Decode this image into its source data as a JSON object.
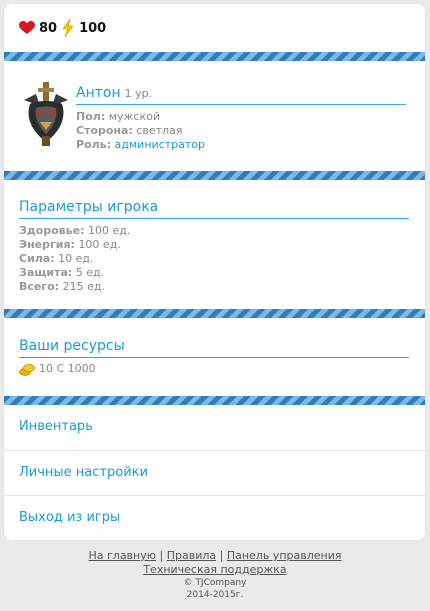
{
  "header": {
    "health_value": "80",
    "energy_value": "100"
  },
  "profile": {
    "name": "Антон",
    "level": "1 ур.",
    "fields": [
      {
        "label": "Пол:",
        "value": "мужской"
      },
      {
        "label": "Сторона:",
        "value": "светлая"
      },
      {
        "label": "Роль:",
        "value": "администратор"
      }
    ]
  },
  "stats": {
    "title": "Параметры игрока",
    "rows": [
      {
        "label": "Здоровье:",
        "value": "100 ед."
      },
      {
        "label": "Энергия:",
        "value": "100 ед."
      },
      {
        "label": "Сила:",
        "value": "10 ед."
      },
      {
        "label": "Защита:",
        "value": "5 ед."
      },
      {
        "label": "Всего:",
        "value": "215 ед."
      }
    ]
  },
  "resources": {
    "title": "Ваши ресурсы",
    "gold": "10 С 1000"
  },
  "menu": [
    "Инвентарь",
    "Личные настройки",
    "Выход из игры"
  ],
  "footer": {
    "links": [
      "На главную",
      "Правила",
      "Панель управления"
    ],
    "separator": " | ",
    "support": "Техническая поддержка",
    "copyright": "© TJCompany",
    "years": "2014-2015г."
  },
  "colors": {
    "accent": "#1a9ad6",
    "stripe_dark": "#2b7fc0",
    "stripe_light": "#7fb9e2"
  }
}
